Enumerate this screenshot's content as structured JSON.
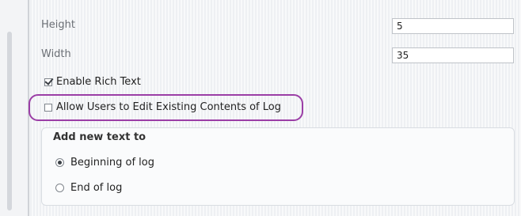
{
  "fields": [
    {
      "label": "Height",
      "value": "5"
    },
    {
      "label": "Width",
      "value": "35"
    }
  ],
  "options": {
    "enable_rich_text": {
      "label": "Enable Rich Text",
      "checked": true
    },
    "allow_edit_existing": {
      "label": "Allow Users to Edit Existing Contents of Log",
      "checked": false
    }
  },
  "add_new_text": {
    "title": "Add new text to",
    "choices": [
      {
        "label": "Beginning of log",
        "selected": true
      },
      {
        "label": "End of log",
        "selected": false
      }
    ]
  },
  "colors": {
    "highlight": "#9b3ea6",
    "panel_bg": "#f3f4f6"
  }
}
